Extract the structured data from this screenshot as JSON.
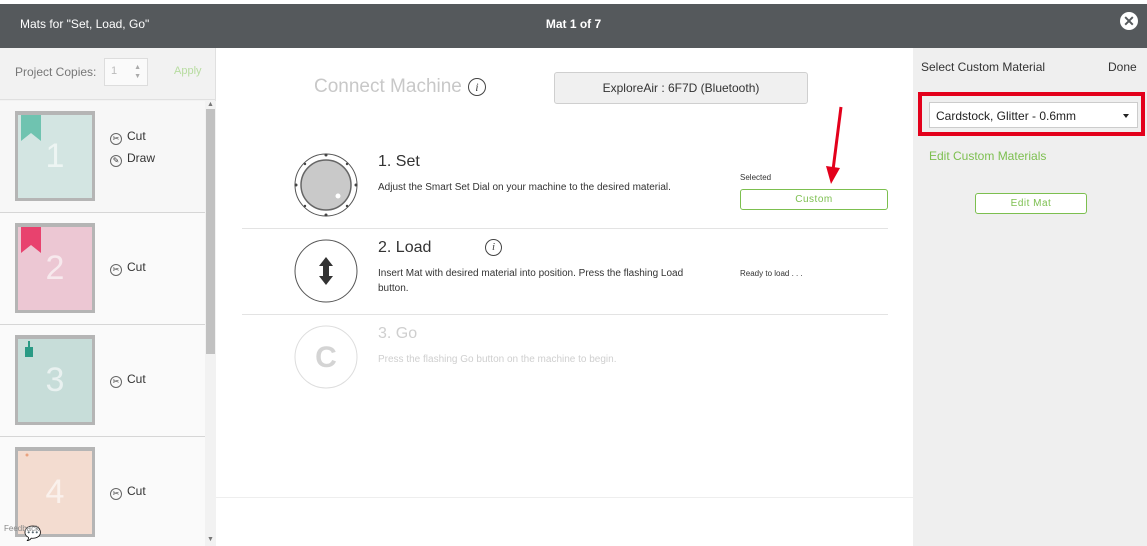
{
  "window": {
    "title": "Mats for \"Set, Load, Go\"",
    "mat_counter": "Mat 1 of 7",
    "close_icon": "close-circle-icon"
  },
  "left_panel": {
    "copies_label": "Project Copies:",
    "copies_value": "1",
    "apply_label": "Apply",
    "feedback_label": "Feedback",
    "mats": [
      {
        "number": "1",
        "color": "#d3e5e2",
        "flag_color": "#6fc3b0",
        "actions": [
          {
            "label": "Cut",
            "icon": "blade-icon"
          },
          {
            "label": "Draw",
            "icon": "pen-icon"
          }
        ]
      },
      {
        "number": "2",
        "color": "#ecc7d3",
        "flag_color": "#e8426e",
        "actions": [
          {
            "label": "Cut",
            "icon": "blade-icon"
          }
        ]
      },
      {
        "number": "3",
        "color": "#c7ddd9",
        "flag_color": "#2a9a85",
        "actions": [
          {
            "label": "Cut",
            "icon": "blade-icon"
          }
        ]
      },
      {
        "number": "4",
        "color": "#f3dcd0",
        "flag_color": "#e9a27f",
        "actions": [
          {
            "label": "Cut",
            "icon": "blade-icon"
          }
        ]
      }
    ]
  },
  "main": {
    "connect_label": "Connect Machine",
    "device_label": "ExploreAir : 6F7D (Bluetooth)",
    "steps": [
      {
        "name": "1. Set",
        "desc": "Adjust the Smart Set Dial on your machine to the desired material.",
        "status": "Selected",
        "button": "Custom"
      },
      {
        "name": "2. Load",
        "desc": "Insert Mat with desired material into position. Press the flashing Load button.",
        "status": "Ready to load . . ."
      },
      {
        "name": "3. Go",
        "desc": "Press the flashing Go button on the machine to begin."
      }
    ]
  },
  "right_panel": {
    "title": "Select Custom Material",
    "done_label": "Done",
    "selected_material": "Cardstock, Glitter - 0.6mm",
    "edit_materials_label": "Edit Custom Materials",
    "edit_mat_label": "Edit Mat"
  },
  "colors": {
    "accent_green": "#7cbf4f",
    "highlight_red": "#e3001b",
    "titlebar": "#55595c"
  }
}
